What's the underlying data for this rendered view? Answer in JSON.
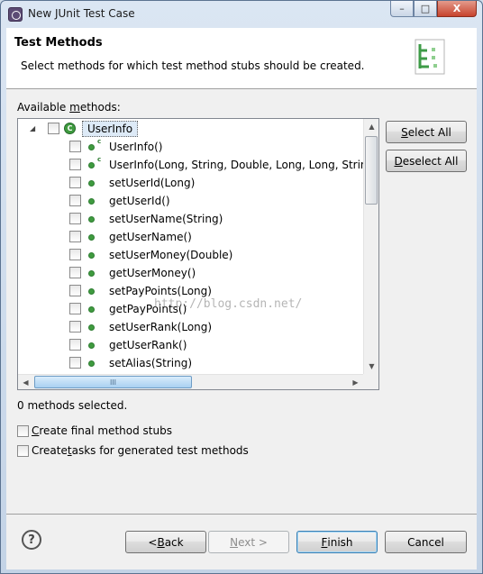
{
  "window": {
    "title": "New JUnit Test Case",
    "minimize_glyph": "–",
    "maximize_glyph": "□",
    "close_glyph": "X"
  },
  "header": {
    "title": "Test Methods",
    "description": "Select methods for which test method stubs should be created."
  },
  "available_methods": {
    "label_before": "Available ",
    "label_mnemonic": "m",
    "label_after": "ethods:"
  },
  "tree": {
    "root": {
      "label": "UserInfo",
      "icon_glyph": "C"
    },
    "methods": [
      {
        "label": "UserInfo()",
        "constructor": true
      },
      {
        "label": "UserInfo(Long, String, Double, Long, Long, String)",
        "constructor": true
      },
      {
        "label": "setUserId(Long)",
        "constructor": false
      },
      {
        "label": "getUserId()",
        "constructor": false
      },
      {
        "label": "setUserName(String)",
        "constructor": false
      },
      {
        "label": "getUserName()",
        "constructor": false
      },
      {
        "label": "setUserMoney(Double)",
        "constructor": false
      },
      {
        "label": "getUserMoney()",
        "constructor": false
      },
      {
        "label": "setPayPoints(Long)",
        "constructor": false
      },
      {
        "label": "getPayPoints()",
        "constructor": false
      },
      {
        "label": "setUserRank(Long)",
        "constructor": false
      },
      {
        "label": "getUserRank()",
        "constructor": false
      },
      {
        "label": "setAlias(String)",
        "constructor": false
      }
    ],
    "constructor_mark": "c",
    "h_thumb_grip": "III"
  },
  "side_buttons": {
    "select_all": {
      "mnemonic": "S",
      "rest": "elect All"
    },
    "deselect_all": {
      "mnemonic": "D",
      "rest": "eselect All"
    }
  },
  "status": {
    "selected_count": "0 methods selected."
  },
  "options": {
    "final_stubs": {
      "mnemonic": "C",
      "rest": "reate final method stubs",
      "checked": false
    },
    "tasks": {
      "before": "Create ",
      "mnemonic": "t",
      "rest": "asks for generated test methods",
      "checked": false
    }
  },
  "footer": {
    "help_glyph": "?",
    "back": {
      "prefix": "< ",
      "mnemonic": "B",
      "rest": "ack"
    },
    "next": {
      "mnemonic": "N",
      "rest": "ext >"
    },
    "finish": {
      "mnemonic": "F",
      "rest": "inish"
    },
    "cancel": {
      "label": "Cancel"
    }
  },
  "watermark": "http://blog.csdn.net/",
  "colors": {
    "method_public": "#3f9b3f",
    "selection": "#ddeaf7",
    "default_button_border": "#3c7fb1"
  }
}
